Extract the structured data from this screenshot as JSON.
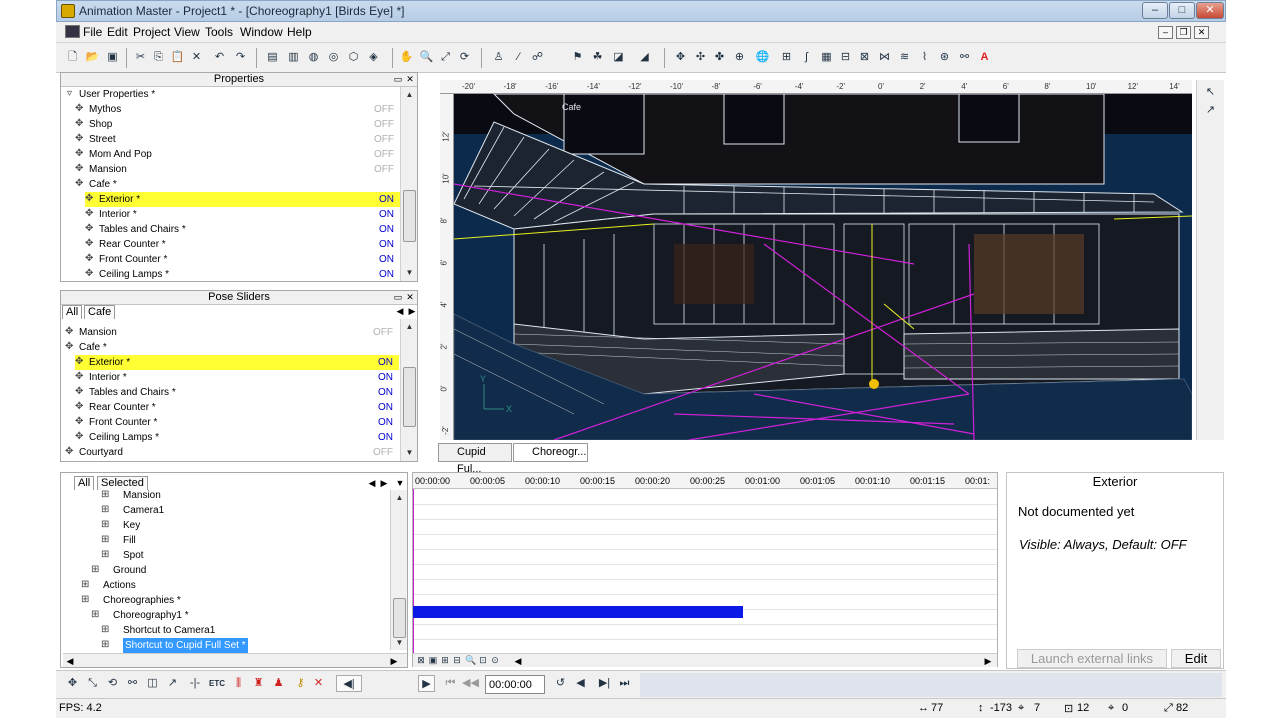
{
  "window": {
    "title": "Animation Master - Project1 * - [Choreography1 [Birds Eye] *]"
  },
  "menu": [
    "File",
    "Edit",
    "Project",
    "View",
    "Tools",
    "Window",
    "Help"
  ],
  "properties_panel": {
    "title": "Properties",
    "group_label": "User Properties *",
    "rows": [
      {
        "name": "Mythos",
        "value": "OFF",
        "indent": 1,
        "highlight": false
      },
      {
        "name": "Shop",
        "value": "OFF",
        "indent": 1,
        "highlight": false
      },
      {
        "name": "Street",
        "value": "OFF",
        "indent": 1,
        "highlight": false
      },
      {
        "name": "Mom And Pop",
        "value": "OFF",
        "indent": 1,
        "highlight": false
      },
      {
        "name": "Mansion",
        "value": "OFF",
        "indent": 1,
        "highlight": false
      },
      {
        "name": "Cafe *",
        "value": "",
        "indent": 1,
        "highlight": false
      },
      {
        "name": "Exterior *",
        "value": "ON",
        "indent": 2,
        "highlight": true
      },
      {
        "name": "Interior *",
        "value": "ON",
        "indent": 2,
        "highlight": false
      },
      {
        "name": "Tables and Chairs *",
        "value": "ON",
        "indent": 2,
        "highlight": false
      },
      {
        "name": "Rear Counter *",
        "value": "ON",
        "indent": 2,
        "highlight": false
      },
      {
        "name": "Front Counter *",
        "value": "ON",
        "indent": 2,
        "highlight": false
      },
      {
        "name": "Ceiling Lamps *",
        "value": "ON",
        "indent": 2,
        "highlight": false
      }
    ]
  },
  "pose_sliders": {
    "title": "Pose Sliders",
    "tabs": [
      "All",
      "Cafe"
    ],
    "rows": [
      {
        "name": "Mansion",
        "value": "OFF",
        "indent": 0,
        "highlight": false
      },
      {
        "name": "Cafe *",
        "value": "",
        "indent": 0,
        "highlight": false
      },
      {
        "name": "Exterior *",
        "value": "ON",
        "indent": 1,
        "highlight": true
      },
      {
        "name": "Interior *",
        "value": "ON",
        "indent": 1,
        "highlight": false
      },
      {
        "name": "Tables and Chairs *",
        "value": "ON",
        "indent": 1,
        "highlight": false
      },
      {
        "name": "Rear Counter *",
        "value": "ON",
        "indent": 1,
        "highlight": false
      },
      {
        "name": "Front Counter *",
        "value": "ON",
        "indent": 1,
        "highlight": false
      },
      {
        "name": "Ceiling Lamps *",
        "value": "ON",
        "indent": 1,
        "highlight": false
      },
      {
        "name": "Courtyard",
        "value": "OFF",
        "indent": 0,
        "highlight": false
      }
    ]
  },
  "viewport": {
    "ruler_labels": [
      "-20'",
      "-18'",
      "-16'",
      "-14'",
      "-12'",
      "-10'",
      "-8'",
      "-6'",
      "-4'",
      "-2'",
      "0'",
      "2'",
      "4'",
      "6'",
      "8'",
      "10'",
      "12'",
      "14'"
    ],
    "vruler_labels": [
      "12'",
      "10'",
      "8'",
      "6'",
      "4'",
      "2'",
      "0'",
      "-2'"
    ],
    "sign_text": "Cafe",
    "axis_x": "X",
    "axis_y": "Y"
  },
  "view_tabs": [
    "Cupid Ful...",
    "Choreogr..."
  ],
  "project_tree": {
    "tabs": [
      "All",
      "Selected"
    ],
    "rows": [
      {
        "name": "Mansion",
        "indent": 3
      },
      {
        "name": "Camera1",
        "indent": 3
      },
      {
        "name": "Key",
        "indent": 3
      },
      {
        "name": "Fill",
        "indent": 3
      },
      {
        "name": "Spot",
        "indent": 3
      },
      {
        "name": "Ground",
        "indent": 2
      },
      {
        "name": "Actions",
        "indent": 1
      },
      {
        "name": "Choreographies *",
        "indent": 1
      },
      {
        "name": "Choreography1 *",
        "indent": 2
      },
      {
        "name": "Shortcut to Camera1",
        "indent": 3
      },
      {
        "name": "Shortcut to Cupid Full Set *",
        "indent": 3
      }
    ]
  },
  "timeline": {
    "times": [
      "00:00:00",
      "00:00:05",
      "00:00:10",
      "00:00:15",
      "00:00:20",
      "00:00:25",
      "00:01:00",
      "00:01:05",
      "00:01:10",
      "00:01:15",
      "00:01:"
    ],
    "bar_color": "#0a19e6",
    "bar_start_fraction": 0,
    "bar_end_fraction": 0.565
  },
  "info": {
    "title": "Exterior",
    "doc": "Not documented yet",
    "visible": "Visible: Always, Default: OFF",
    "launch_label": "Launch external links",
    "edit_label": "Edit"
  },
  "playback": {
    "time": "00:00:00",
    "etc_label": "ETC"
  },
  "status": {
    "fps": "FPS: 4.2",
    "x": "77",
    "y": "-173",
    "a": "7",
    "b": "12",
    "c": "0",
    "d": "82"
  },
  "colors": {
    "accent_highlight": "#ffff33",
    "viewport_bg": "#0c2a4b",
    "wire": "#dfe7ef",
    "magenta": "#d020d8"
  }
}
